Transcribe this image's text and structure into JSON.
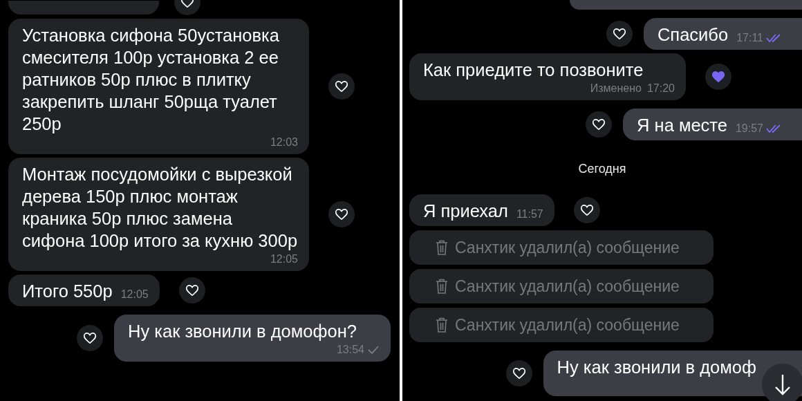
{
  "panels": [
    {
      "messages": [
        {
          "kind": "stub_in",
          "reaction": {
            "liked": false
          }
        },
        {
          "kind": "incoming",
          "text": "Установка сифона 50установка смесителя 100р установка 2 ее ратников 50р плюс в плитку закрепить шланг 50рща туалет 250р",
          "time": "12:03",
          "reaction": {
            "liked": false
          }
        },
        {
          "kind": "incoming",
          "text": "Монтаж посудомойки с вырезкой дерева 150р плюс монтаж краника 50р плюс замена сифона 100р итого за кухню 300р",
          "time": "12:05",
          "reaction": {
            "liked": false
          }
        },
        {
          "kind": "incoming",
          "text": "Итого 550р",
          "time": "12:05",
          "reaction": {
            "liked": false
          }
        },
        {
          "kind": "outgoing",
          "text": "Ну как звонили в домофон?",
          "time": "13:54",
          "read": false,
          "reaction": {
            "liked": false
          }
        }
      ]
    },
    {
      "messages": [
        {
          "kind": "stub_out"
        },
        {
          "kind": "outgoing",
          "text": "Спасибо",
          "time": "17:11",
          "read": true,
          "reaction": {
            "liked": false
          }
        },
        {
          "kind": "incoming",
          "text": "Как приедите то позвоните",
          "edited": "Изменено",
          "time": "17:20",
          "reaction": {
            "liked": true
          }
        },
        {
          "kind": "outgoing",
          "text": "Я на месте",
          "time": "19:57",
          "read": true,
          "reaction": {
            "liked": false
          }
        },
        {
          "kind": "date",
          "text": "Сегодня"
        },
        {
          "kind": "incoming",
          "text": "Я приехал",
          "time": "11:57",
          "reaction": {
            "liked": false
          }
        },
        {
          "kind": "deleted",
          "text": "Санхтик удалил(а) сообщение"
        },
        {
          "kind": "deleted",
          "text": "Санхтик удалил(а) сообщение"
        },
        {
          "kind": "deleted",
          "text": "Санхтик удалил(а) сообщение"
        },
        {
          "kind": "outgoing",
          "text": "Ну как звонили в домоф",
          "reaction": {
            "liked": false
          }
        }
      ],
      "scroll_down_button": true
    }
  ]
}
